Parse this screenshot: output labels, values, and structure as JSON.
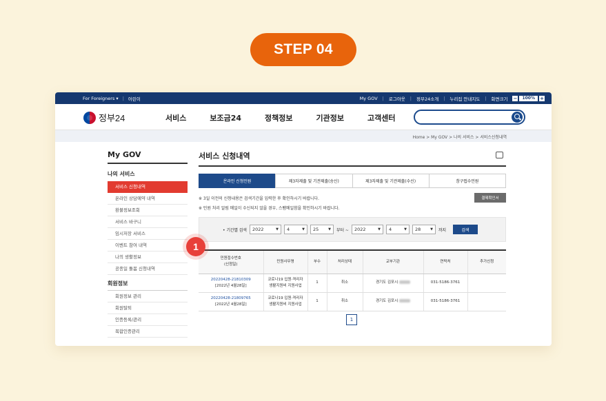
{
  "step_label": "STEP 04",
  "topbar": {
    "foreigners": "For Foreigners ▾",
    "lang": "어린이",
    "right": [
      "My GOV",
      "로그아웃",
      "정부24소개",
      "누리집 안내지도",
      "화면크기"
    ],
    "zoom_minus": "−",
    "zoom_value": "100%",
    "zoom_plus": "+"
  },
  "header": {
    "logo_text": "정부24",
    "nav": [
      "서비스",
      "보조금24",
      "정책정보",
      "기관정보",
      "고객센터"
    ],
    "search_placeholder": ""
  },
  "breadcrumb": "Home > My GOV > 나의 서비스 > 서비스신청내역",
  "sidebar": {
    "title": "My GOV",
    "section1": "나의 서비스",
    "items1": [
      "서비스 신청내역",
      "온라인 상담예약 내역",
      "환불정보조회",
      "서비스 바구니",
      "임시저장 서비스",
      "이벤트 참여 내역",
      "나의 생활정보",
      "공종일 돌봄 신청내역"
    ],
    "section2": "회원정보",
    "items2": [
      "회원정보 관리",
      "회원탈퇴",
      "인증등록/관리",
      "복합인증관리"
    ]
  },
  "main": {
    "title": "서비스 신청내역",
    "tabs": [
      "온라인 신청민원",
      "제3자제출 및 기관제출(송신)",
      "제3자제출 및 기관제출(수신)",
      "창구접수민원"
    ],
    "note1": "※ 3일 이전의 신청내용은 검색기간을 입력한 후 확인하시기 바랍니다.",
    "note2": "※ 민원 처리 알림 메일이 수신되지 않을 경우, 스팸메일함을 확인하시기 바랍니다.",
    "confirm_button": "결제확인서",
    "filter": {
      "label": "• 기간별 검색",
      "from_year": "2022",
      "from_month": "4",
      "from_day": "25",
      "from_suffix": "부터 ~",
      "to_year": "2022",
      "to_month": "4",
      "to_day": "28",
      "to_suffix": "까지",
      "search_button": "검색"
    },
    "table": {
      "headers": [
        "민원접수번호\n(신청일)",
        "민원사무명",
        "부수",
        "처리상태",
        "교부기관",
        "연락처",
        "추가신청"
      ],
      "rows": [
        {
          "no": "20220428-21810309",
          "date": "[2022년 4월28일]",
          "name1": "코로나19 입원·격리자",
          "name2": "생활지원비 지원사업",
          "count": "1",
          "status": "취소",
          "agency": "경기도 김포시",
          "phone": "031-5186-3761",
          "extra": ""
        },
        {
          "no": "20220428-21809765",
          "date": "[2022년 4월28일]",
          "name1": "코로나19 입원·격리자",
          "name2": "생활지원비 지원사업",
          "count": "1",
          "status": "취소",
          "agency": "경기도 김포시",
          "phone": "031-5186-3761",
          "extra": ""
        }
      ]
    },
    "page": "1"
  },
  "marker_number": "1"
}
